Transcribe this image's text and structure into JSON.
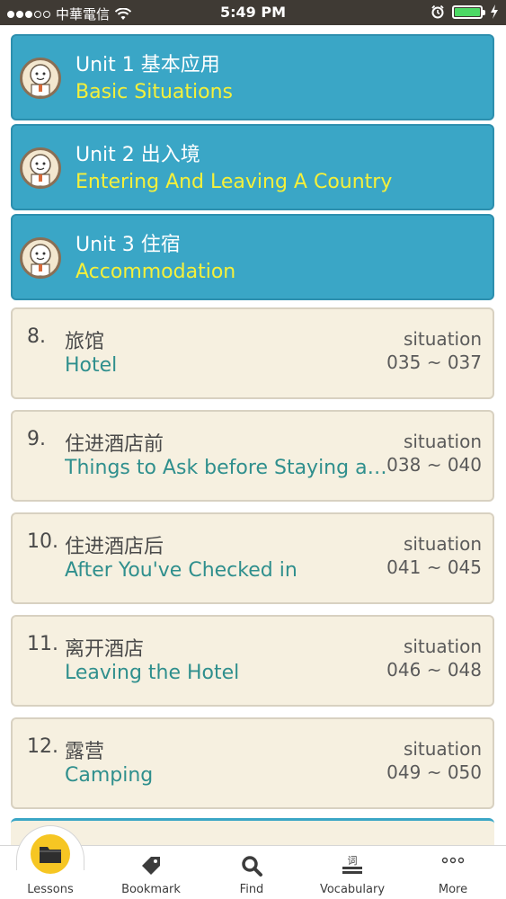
{
  "status_bar": {
    "carrier": "中華電信",
    "time": "5:49 PM"
  },
  "units": [
    {
      "title": "Unit 1 基本应用",
      "subtitle": "Basic Situations"
    },
    {
      "title": "Unit 2 出入境",
      "subtitle": "Entering And Leaving A Country"
    },
    {
      "title": "Unit 3 住宿",
      "subtitle": "Accommodation"
    }
  ],
  "lessons": [
    {
      "number": "8.",
      "title": "旅馆",
      "subtitle": "Hotel",
      "situation_label": "situation",
      "range": "035 ~ 037"
    },
    {
      "number": "9.",
      "title": "住进酒店前",
      "subtitle": "Things to Ask before Staying at...",
      "situation_label": "situation",
      "range": "038 ~ 040"
    },
    {
      "number": "10.",
      "title": "住进酒店后",
      "subtitle": "After You've Checked in",
      "situation_label": "situation",
      "range": "041 ~ 045"
    },
    {
      "number": "11.",
      "title": "离开酒店",
      "subtitle": "Leaving the Hotel",
      "situation_label": "situation",
      "range": "046 ~ 048"
    },
    {
      "number": "12.",
      "title": "露营",
      "subtitle": "Camping",
      "situation_label": "situation",
      "range": "049 ~ 050"
    }
  ],
  "tabs": [
    {
      "label": "Lessons",
      "icon": "folder-icon"
    },
    {
      "label": "Bookmark",
      "icon": "tag-icon"
    },
    {
      "label": "Find",
      "icon": "search-icon"
    },
    {
      "label": "Vocabulary",
      "icon": "book-icon"
    },
    {
      "label": "More",
      "icon": "more-icon"
    }
  ],
  "colors": {
    "unit_bg": "#3aa6c6",
    "unit_subtitle": "#f5f03a",
    "lesson_bg": "#f6f0e0",
    "lesson_subtitle": "#2f8f8d",
    "active_tab": "#f6c623"
  }
}
